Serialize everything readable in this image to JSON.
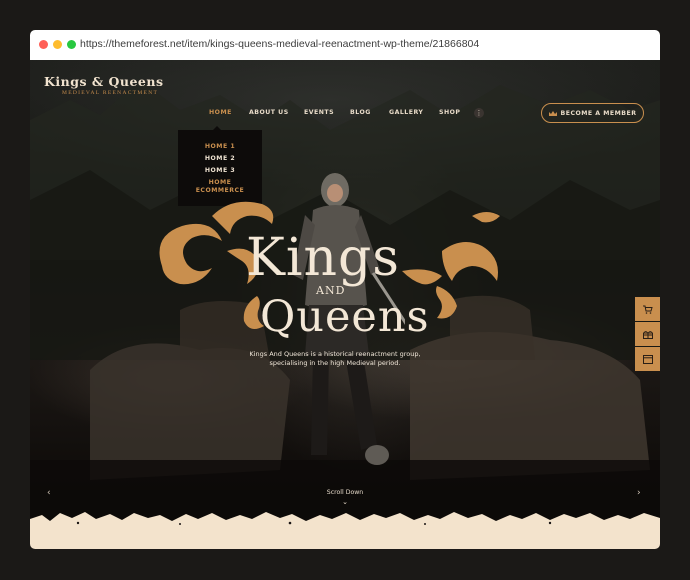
{
  "browser": {
    "url": "https://themeforest.net/item/kings-queens-medieval-reenactment-wp-theme/21866804"
  },
  "logo": {
    "main": "Kings & Queens",
    "sub": "MEDIEVAL REENACTMENT"
  },
  "nav": {
    "items": [
      {
        "label": "HOME",
        "active": true
      },
      {
        "label": "ABOUT US"
      },
      {
        "label": "EVENTS"
      },
      {
        "label": "BLOG"
      },
      {
        "label": "GALLERY"
      },
      {
        "label": "SHOP"
      }
    ],
    "more_label": "⋮",
    "member_button": "BECOME A MEMBER"
  },
  "dropdown": {
    "items": [
      "HOME 1",
      "HOME 2",
      "HOME 3",
      "HOME",
      "ECOMMERCE"
    ]
  },
  "hero": {
    "title_line1": "Kings",
    "title_and": "AND",
    "title_line2": "Queens",
    "description_line1": "Kings And Queens is a historical reenactment group,",
    "description_line2": "specialising in the high Medieval period.",
    "scroll_label": "Scroll Down",
    "prev_arrow": "‹",
    "next_arrow": "›",
    "scroll_chevron": "⌄"
  },
  "side_panel": {
    "icons": [
      "cart-icon",
      "gift-icon",
      "browser-icon"
    ]
  },
  "colors": {
    "accent": "#c98f4e",
    "cream": "#f3e3cc",
    "dark": "#0f0d0b"
  }
}
